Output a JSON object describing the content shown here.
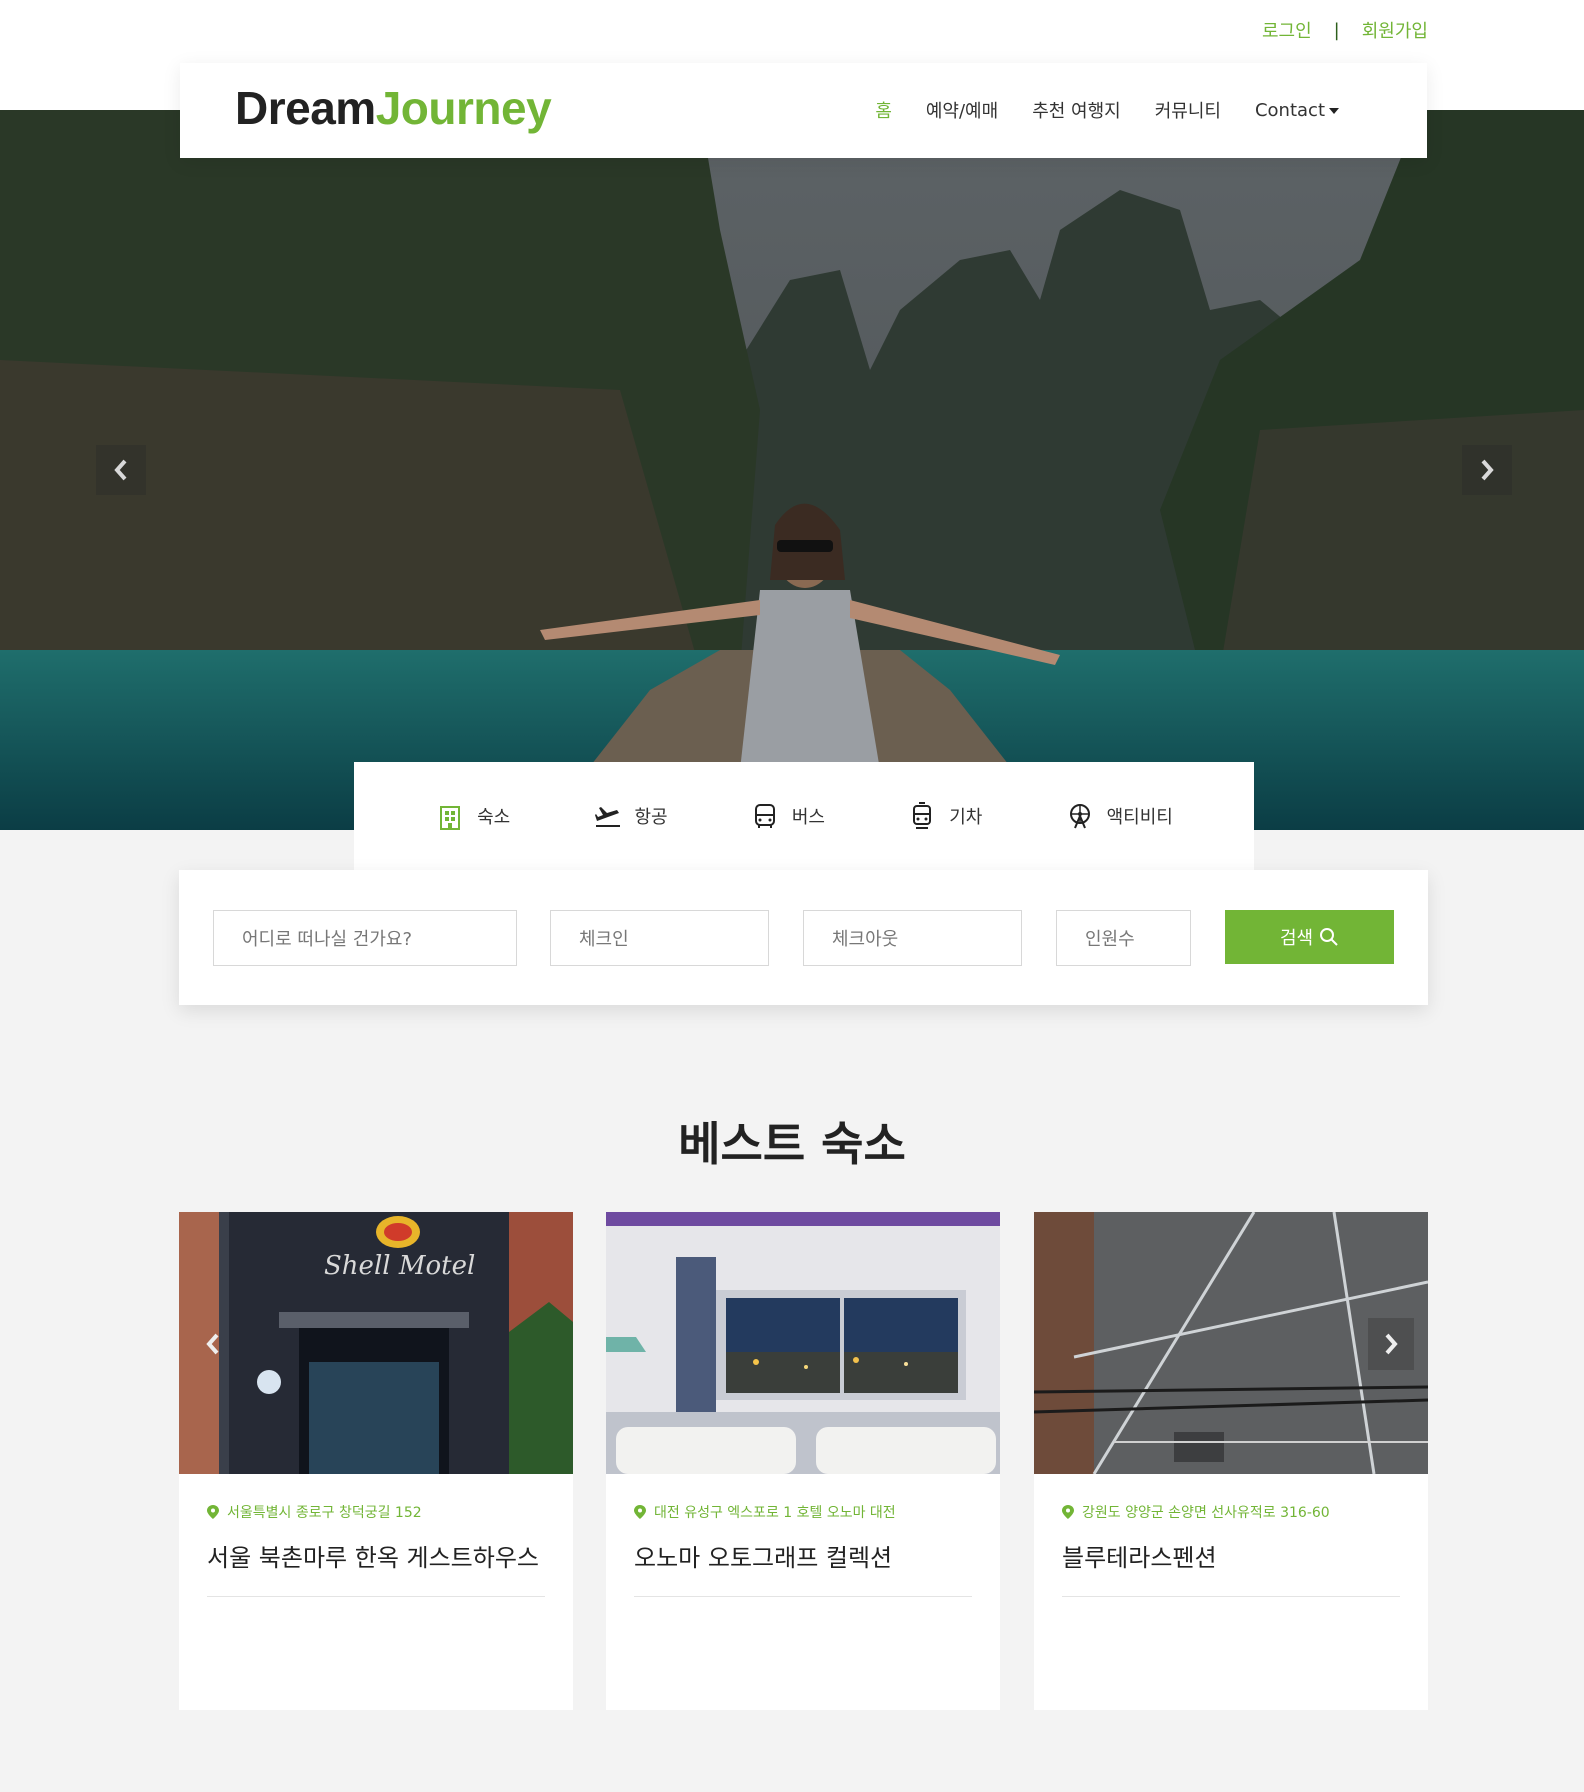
{
  "auth": {
    "login": "로그인",
    "separator": "|",
    "signup": "회원가입"
  },
  "brand": {
    "part1": "Dream",
    "part2": "Journey",
    "accent": "#72b536"
  },
  "nav": {
    "items": [
      {
        "label": "홈",
        "active": true
      },
      {
        "label": "예약/예매"
      },
      {
        "label": "추천 여행지"
      },
      {
        "label": "커뮤니티"
      },
      {
        "label": "Contact"
      }
    ]
  },
  "carousel": {
    "prev_icon": "chevron-left-icon",
    "next_icon": "chevron-right-icon"
  },
  "tabs": [
    {
      "label": "숙소",
      "icon": "building-icon",
      "active": true
    },
    {
      "label": "항공",
      "icon": "plane-departure-icon"
    },
    {
      "label": "버스",
      "icon": "bus-icon"
    },
    {
      "label": "기차",
      "icon": "train-icon"
    },
    {
      "label": "액티비티",
      "icon": "ferris-wheel-icon"
    }
  ],
  "search": {
    "destination_placeholder": "어디로 떠나실 건가요?",
    "checkin_placeholder": "체크인",
    "checkout_placeholder": "체크아웃",
    "guests_placeholder": "인원수",
    "button_label": "검색"
  },
  "best_section": {
    "title": "베스트 숙소",
    "cards": [
      {
        "address": "서울특별시 종로구 창덕궁길 152",
        "name": "서울 북촌마루 한옥 게스트하우스",
        "sign": "Shell Motel"
      },
      {
        "address": "대전 유성구 엑스포로 1 호텔 오노마 대전",
        "name": "오노마 오토그래프 컬렉션"
      },
      {
        "address": "강원도 양양군 손양면 선사유적로 316-60",
        "name": "블루테라스펜션"
      }
    ]
  }
}
